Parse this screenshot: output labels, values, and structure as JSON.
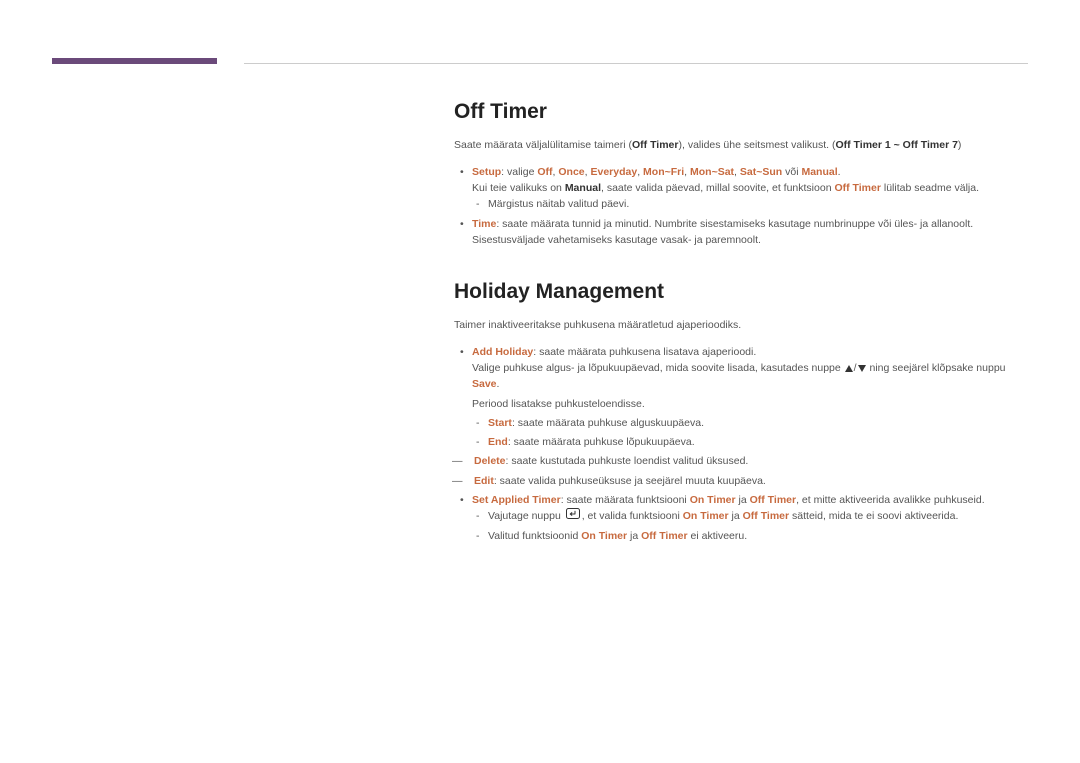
{
  "sections": {
    "offTimer": {
      "title": "Off Timer",
      "intro_pre": "Saate määrata väljalülitamise taimeri (",
      "intro_bold1": "Off Timer",
      "intro_mid": "), valides ühe seitsmest valikust. (",
      "intro_bold2": "Off Timer 1 ~ Off Timer 7",
      "intro_post": ")",
      "items": [
        {
          "kw": "Setup",
          "text1": ": valige ",
          "opts": [
            "Off",
            "Once",
            "Everyday",
            "Mon~Fri",
            "Mon~Sat",
            "Sat~Sun"
          ],
          "text2": " või ",
          "lastOpt": "Manual",
          "text3": ".",
          "line2_pre": "Kui teie valikuks on ",
          "line2_bold": "Manual",
          "line2_mid": ", saate valida päevad, millal soovite, et funktsioon ",
          "line2_kw": "Off Timer",
          "line2_post": " lülitab seadme välja.",
          "sub": "Märgistus näitab valitud päevi."
        },
        {
          "kw": "Time",
          "text": ": saate määrata tunnid ja minutid. Numbrite sisestamiseks kasutage numbrinuppe või üles- ja allanoolt. Sisestusväljade vahetamiseks kasutage vasak- ja paremnoolt."
        }
      ]
    },
    "holiday": {
      "title": "Holiday Management",
      "intro": "Taimer inaktiveeritakse puhkusena määratletud ajaperioodiks.",
      "addHoliday": {
        "kw": "Add Holiday",
        "text": ": saate määrata puhkusena lisatava ajaperioodi.",
        "line2_pre": "Valige puhkuse algus- ja lõpukuupäevad, mida soovite lisada, kasutades nuppe ",
        "line2_post": " ning seejärel klõpsake nuppu ",
        "line2_save": "Save",
        "line2_end": ".",
        "line3": "Periood lisatakse puhkusteloendisse.",
        "start": {
          "kw": "Start",
          "text": ": saate määrata puhkuse alguskuupäeva."
        },
        "end": {
          "kw": "End",
          "text": ": saate määrata puhkuse lõpukuupäeva."
        }
      },
      "delete": {
        "kw": "Delete",
        "text": ": saate kustutada puhkuste loendist valitud üksused."
      },
      "edit": {
        "kw": "Edit",
        "text": ": saate valida puhkuseüksuse ja seejärel muuta kuupäeva."
      },
      "setApplied": {
        "kw": "Set Applied Timer",
        "pre": ": saate määrata funktsiooni ",
        "on": "On Timer",
        "mid1": " ja ",
        "off": "Off Timer",
        "post": ", et mitte aktiveerida avalikke puhkuseid.",
        "sub1_pre": "Vajutage nuppu ",
        "sub1_mid": ", et valida funktsiooni ",
        "sub1_on": "On Timer",
        "sub1_ja": " ja ",
        "sub1_off": "Off Timer",
        "sub1_post": " sätteid, mida te ei soovi aktiveerida.",
        "sub2_pre": "Valitud funktsioonid ",
        "sub2_on": "On Timer",
        "sub2_ja": " ja ",
        "sub2_off": "Off Timer",
        "sub2_post": " ei aktiveeru."
      }
    }
  }
}
